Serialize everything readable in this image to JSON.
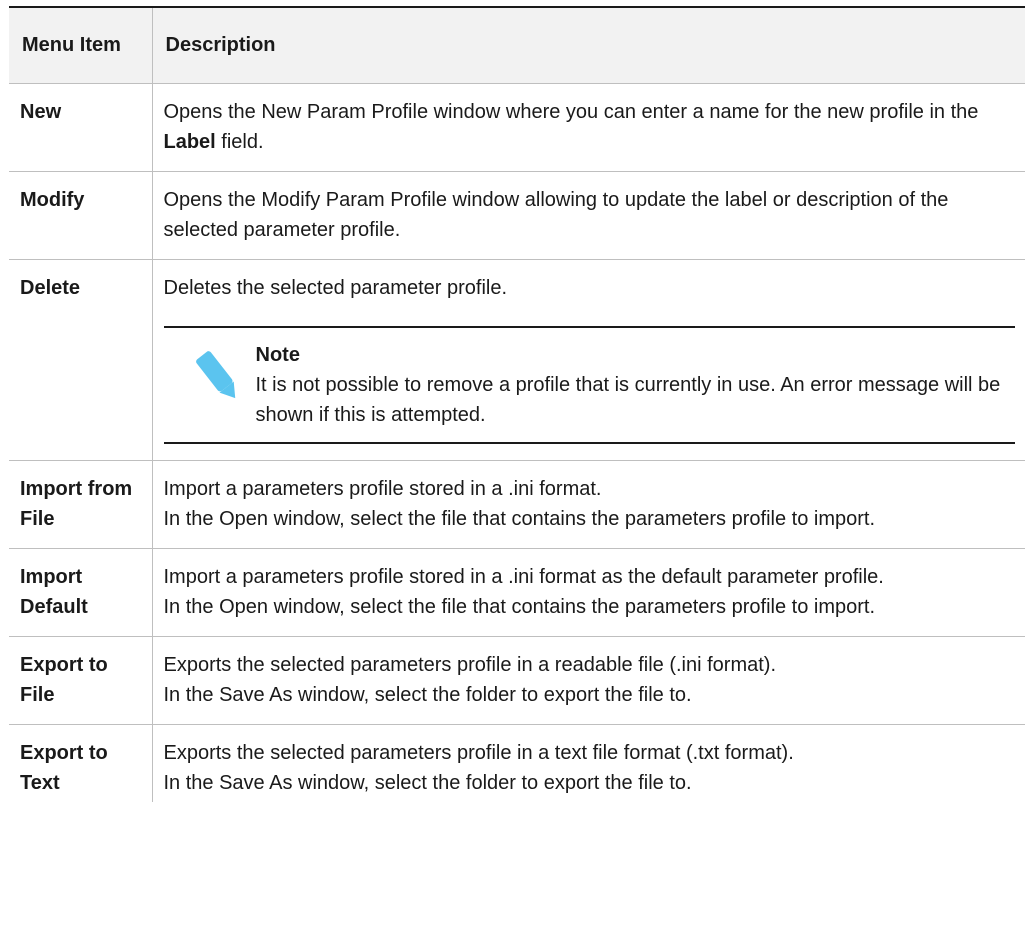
{
  "table": {
    "headers": {
      "menu_item": "Menu Item",
      "description": "Description"
    },
    "rows": [
      {
        "item": "New",
        "desc_before": "Opens the New Param Profile window where you can enter a name for the new profile in the ",
        "desc_bold": "Label",
        "desc_after": " field."
      },
      {
        "item": "Modify",
        "desc": "Opens the Modify Param Profile window allowing to update the label or description of the selected parameter profile."
      },
      {
        "item": "Delete",
        "desc": "Deletes the selected parameter profile.",
        "note": {
          "icon": "pencil-icon",
          "icon_color": "#5bc4ef",
          "title": "Note",
          "text": "It is not possible to remove a profile that is currently in use. An error message will be shown if this is attempted."
        }
      },
      {
        "item": "Import from File",
        "lines": [
          "Import a parameters profile stored in a .ini format.",
          "In the Open window, select the file that contains the parameters profile to import."
        ]
      },
      {
        "item": "Import Default",
        "lines": [
          "Import a parameters profile stored in a .ini format as the default parameter profile.",
          "In the Open window, select the file that contains the parameters profile to import."
        ]
      },
      {
        "item": "Export to File",
        "lines": [
          "Exports the selected parameters profile in a readable file (.ini format).",
          "In the Save As window, select the folder to export the file to."
        ]
      },
      {
        "item": "Export to Text",
        "lines": [
          "Exports the selected parameters profile in a text file format (.txt format).",
          "In the Save As window, select the folder to export the file to."
        ]
      }
    ]
  }
}
